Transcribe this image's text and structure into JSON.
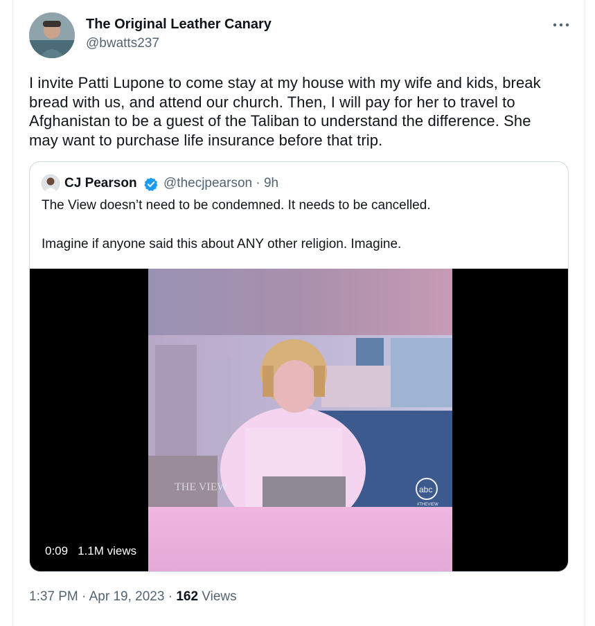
{
  "tweet": {
    "author_name": "The Original Leather Canary",
    "author_handle": "@bwatts237",
    "text": "I invite Patti Lupone to come stay at my house with my wife and kids, break bread with us, and attend our church. Then, I will pay for her to travel to Afghanistan to be a guest of the Taliban to understand the difference. She may want to purchase life insurance before that trip.",
    "time": "1:37 PM",
    "separator": "·",
    "date": "Apr 19, 2023",
    "views_count": "162",
    "views_label": "Views"
  },
  "quoted": {
    "author_name": "CJ Pearson",
    "verified": true,
    "handle_time": "@thecjpearson · 9h",
    "line1": "The View doesn’t need to be condemned. It needs to be cancelled.",
    "line2": "Imagine if anyone said this about ANY other religion. Imagine.",
    "video": {
      "duration": "0:09",
      "views": "1.1M views",
      "watermark_left": "THE VIEW",
      "watermark_right": "abc",
      "watermark_right_sub": "#THEVIEW"
    }
  },
  "icons": {
    "more": "more-dots-icon",
    "verified": "verified-badge-icon"
  },
  "colors": {
    "accent": "#1d9bf0",
    "secondary_text": "#536471",
    "border": "#cfd9de"
  }
}
